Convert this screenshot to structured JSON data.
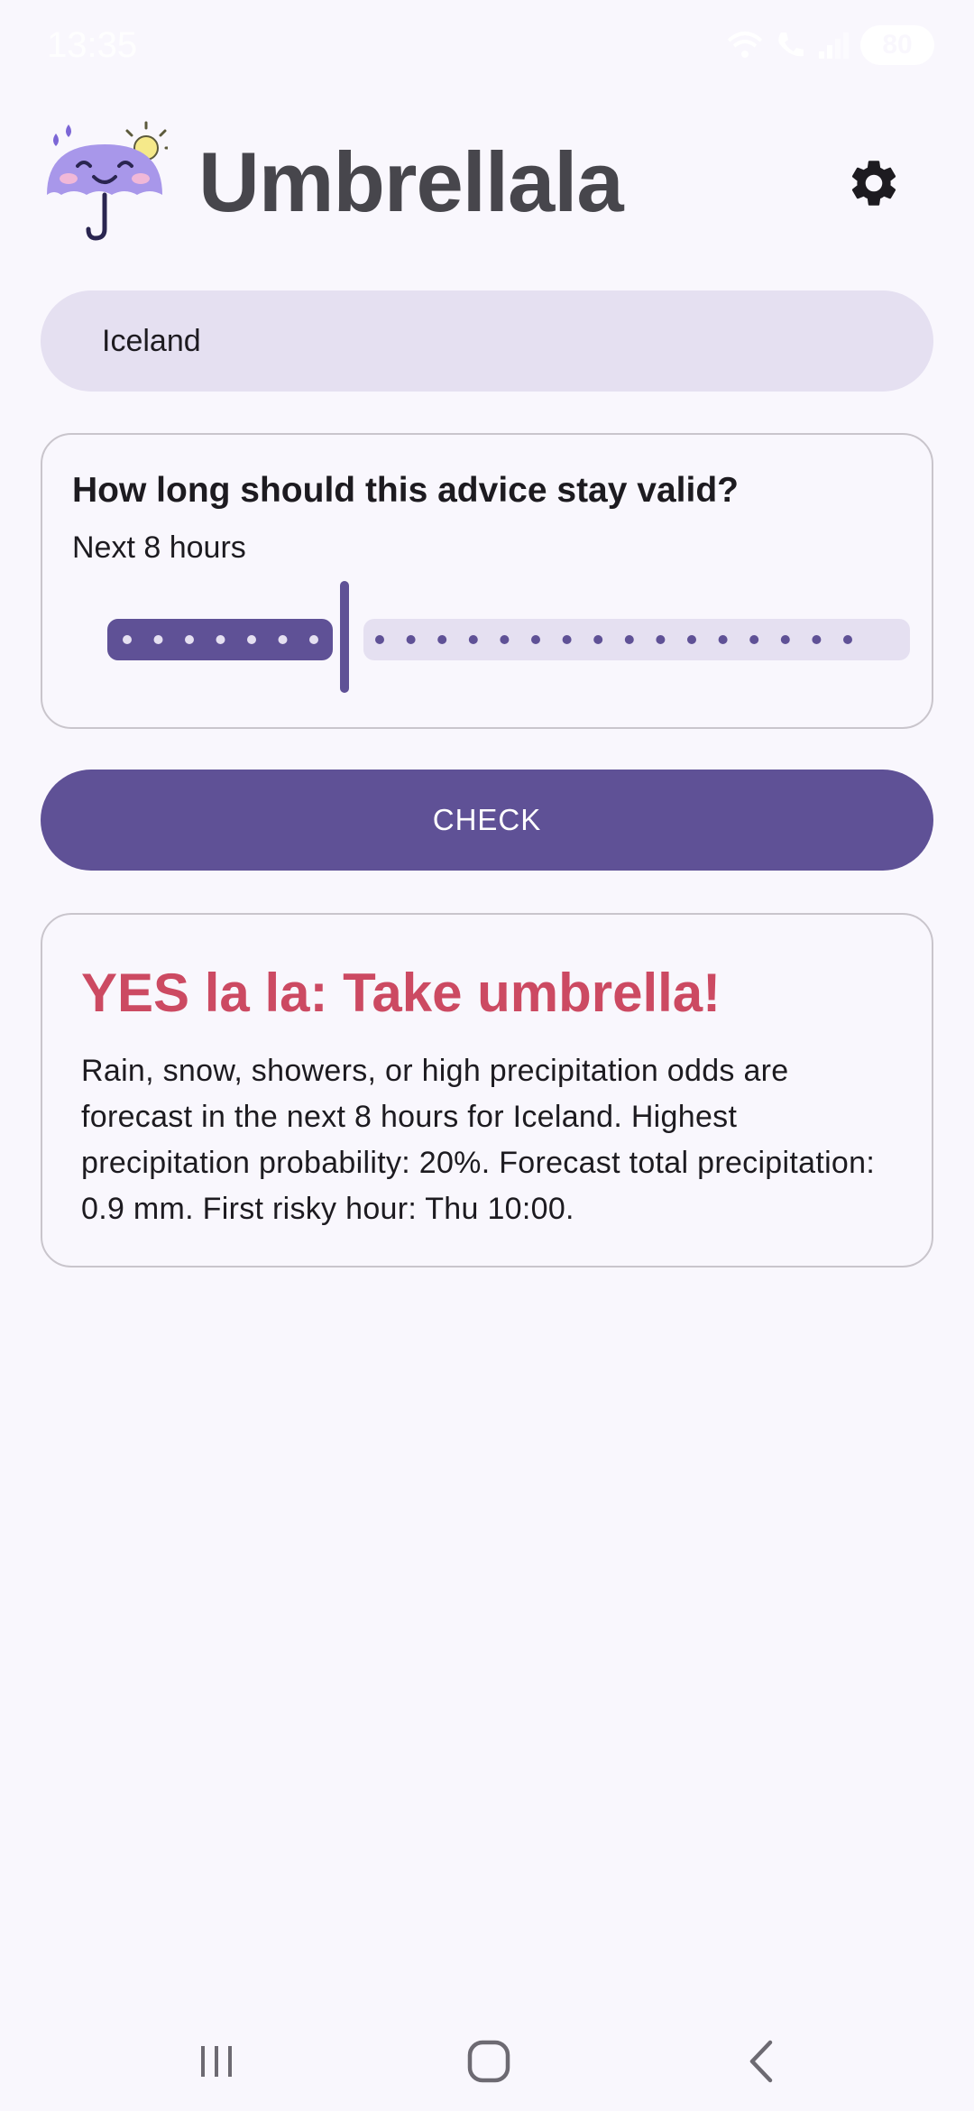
{
  "status_bar": {
    "time": "13:35",
    "battery": "80"
  },
  "header": {
    "app_title": "Umbrellala",
    "logo_icon": "umbrella-mascot-icon",
    "settings_icon": "gear-icon"
  },
  "location": {
    "value": "Iceland"
  },
  "duration": {
    "question": "How long should this advice stay valid?",
    "value_label": "Next 8 hours",
    "slider_value_hours": 8
  },
  "check_button": {
    "label": "CHECK"
  },
  "result": {
    "headline": "YES la la: Take umbrella!",
    "detail": "Rain, snow, showers, or high precipitation odds are forecast in the next 8 hours for Iceland. Highest precipitation probability: 20%. Forecast total precipitation: 0.9 mm. First risky hour: Thu 10:00."
  },
  "nav_bar": {
    "recents_icon": "recents-icon",
    "home_icon": "home-icon",
    "back_icon": "back-icon"
  },
  "colors": {
    "background": "#f9f7fd",
    "primary": "#5f5196",
    "primary_container": "#e5e0f1",
    "alert_red": "#cc4a62",
    "title_gray": "#47464c"
  }
}
